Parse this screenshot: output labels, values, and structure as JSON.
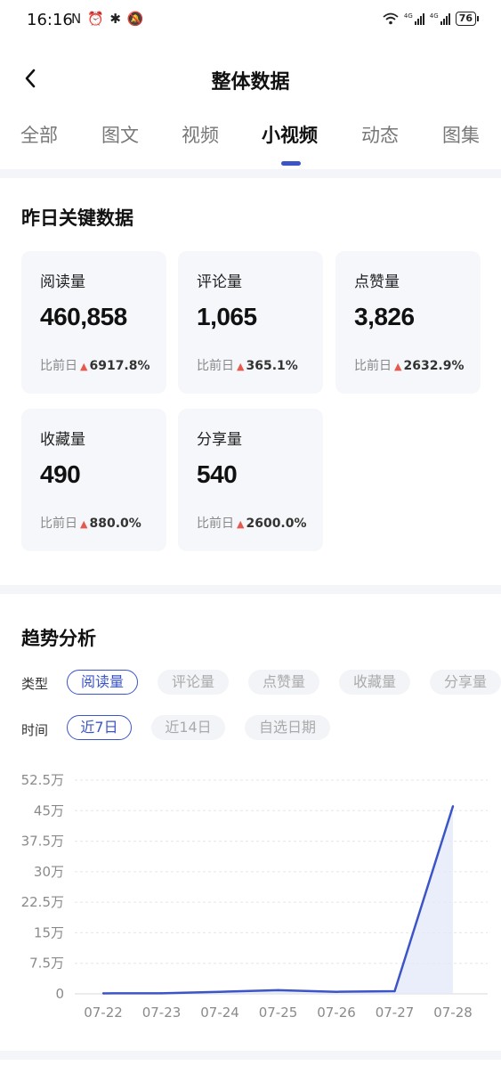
{
  "status_bar": {
    "time": "16:16",
    "left_icons": "N ⏰ ✱ 🔕",
    "network_1": "4G",
    "network_2": "4G",
    "battery": "76"
  },
  "header": {
    "title": "整体数据",
    "back_icon": "chevron-left-icon"
  },
  "tabs": [
    {
      "label": "全部"
    },
    {
      "label": "图文"
    },
    {
      "label": "视频"
    },
    {
      "label": "小视频",
      "active": true
    },
    {
      "label": "动态"
    },
    {
      "label": "图集"
    }
  ],
  "key_data": {
    "title": "昨日关键数据",
    "compare_prefix": "比前日",
    "cards": [
      {
        "label": "阅读量",
        "value": "460,858",
        "change": "6917.8%"
      },
      {
        "label": "评论量",
        "value": "1,065",
        "change": "365.1%"
      },
      {
        "label": "点赞量",
        "value": "3,826",
        "change": "2632.9%"
      },
      {
        "label": "收藏量",
        "value": "490",
        "change": "880.0%"
      },
      {
        "label": "分享量",
        "value": "540",
        "change": "2600.0%"
      }
    ]
  },
  "trend": {
    "title": "趋势分析",
    "type_label": "类型",
    "type_options": [
      "阅读量",
      "评论量",
      "点赞量",
      "收藏量",
      "分享量"
    ],
    "type_selected": "阅读量",
    "time_label": "时间",
    "time_options": [
      "近7日",
      "近14日",
      "自选日期"
    ],
    "time_selected": "近7日"
  },
  "chart_data": {
    "type": "area",
    "categories": [
      "07-22",
      "07-23",
      "07-24",
      "07-25",
      "07-26",
      "07-27",
      "07-28"
    ],
    "y_tick_labels": [
      "0",
      "7.5万",
      "15万",
      "22.5万",
      "30万",
      "37.5万",
      "45万",
      "52.5万"
    ],
    "series": [
      {
        "values": [
          1200,
          1500,
          5000,
          9000,
          5000,
          6570,
          460858
        ]
      }
    ],
    "ylim": [
      0,
      525000
    ],
    "grid": true,
    "line_color": "#3b55c6",
    "fill_color": "#e3e8fa"
  }
}
